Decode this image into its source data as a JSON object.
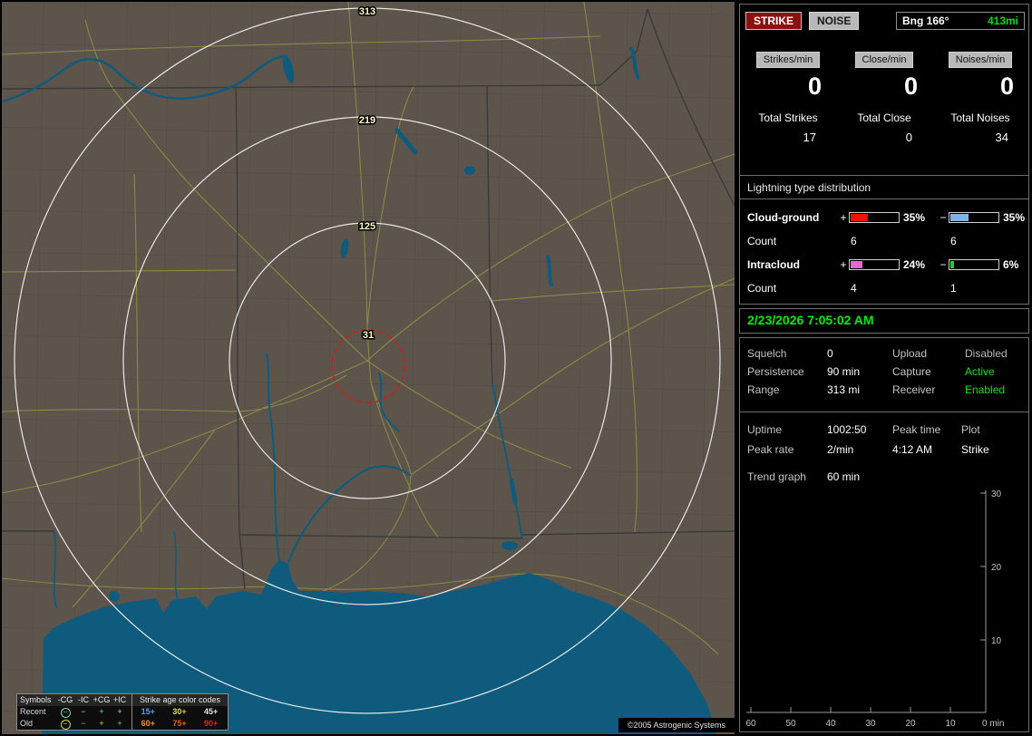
{
  "map": {
    "ring_labels": [
      "313",
      "219",
      "125",
      "31"
    ],
    "copyright": "©2005 Astrogenic Systems"
  },
  "legend": {
    "symbols_title": "Symbols",
    "col_headers": [
      "-CG",
      "-IC",
      "+CG",
      "+IC"
    ],
    "rows": [
      {
        "label": "Recent",
        "cells": [
          {
            "ch": "−",
            "style": "color:#7fd4a0"
          },
          {
            "ch": "−",
            "style": "color:#d0d0d0"
          },
          {
            "ch": "+",
            "style": "color:#7fd4a0"
          },
          {
            "ch": "+",
            "style": "color:#d0d0d0"
          }
        ]
      },
      {
        "label": "Old",
        "cells": [
          {
            "ch": "−",
            "style": "color:#d2d24a"
          },
          {
            "ch": "−",
            "style": "color:#b9b93e"
          },
          {
            "ch": "+",
            "style": "color:#d2d24a"
          },
          {
            "ch": "+",
            "style": "color:#b9b93e"
          }
        ]
      }
    ],
    "age_title": "Strike age color codes",
    "age_rows": [
      [
        {
          "label": "15+",
          "style": "color:#5b9bff"
        },
        {
          "label": "30+",
          "style": "color:#d8d855"
        },
        {
          "label": "45+",
          "style": "color:#e0e0e0"
        }
      ],
      [
        {
          "label": "60+",
          "style": "color:#e8973a"
        },
        {
          "label": "75+",
          "style": "color:#e85c28"
        },
        {
          "label": "90+",
          "style": "color:#e32222"
        }
      ]
    ]
  },
  "panel": {
    "strike_button": "STRIKE",
    "noise_button": "NOISE",
    "bearing_label": "Bng 166°",
    "bearing_value": "413mi",
    "rates": [
      {
        "label": "Strikes/min",
        "value": "0"
      },
      {
        "label": "Close/min",
        "value": "0"
      },
      {
        "label": "Noises/min",
        "value": "0"
      }
    ],
    "totals": [
      {
        "label": "Total Strikes",
        "value": "17"
      },
      {
        "label": "Total Close",
        "value": "0"
      },
      {
        "label": "Total Noises",
        "value": "34"
      }
    ],
    "distribution": {
      "title": "Lightning type distribution",
      "count_label": "Count",
      "rows": [
        {
          "name": "Cloud-ground",
          "plus_sign": "+",
          "plus_pct": "35%",
          "plus_bar": "width:35%;background:#ee1111",
          "minus_sign": "−",
          "minus_pct": "35%",
          "minus_bar": "width:37%;background:#7fb2e5",
          "plus_count": "6",
          "minus_count": "6"
        },
        {
          "name": "Intracloud",
          "plus_sign": "+",
          "plus_pct": "24%",
          "plus_bar": "width:24%;background:#ee66cc",
          "minus_sign": "−",
          "minus_pct": "6%",
          "minus_bar": "width:7%;background:#22cc22",
          "plus_count": "4",
          "minus_count": "1"
        }
      ]
    },
    "datetime": "2/23/2026 7:05:02 AM",
    "settings": [
      {
        "label1": "Squelch",
        "value1": "0",
        "label2": "Upload",
        "value2": "Disabled",
        "value2_style": "color:#b8b8b8"
      },
      {
        "label1": "Persistence",
        "value1": "90 min",
        "label2": "Capture",
        "value2": "Active",
        "value2_style": "color:#19e019"
      },
      {
        "label1": "Range",
        "value1": "313 mi",
        "label2": "Receiver",
        "value2": "Enabled",
        "value2_style": "color:#19e019"
      }
    ],
    "status": {
      "r1": [
        "Uptime",
        "1002:50",
        "Peak time",
        "Plot"
      ],
      "r2": [
        "Peak rate",
        "2/min",
        "4:12 AM",
        "Strike"
      ]
    },
    "trend_label": "Trend graph",
    "trend_value": "60 min",
    "chart": {
      "y_ticks": [
        "30",
        "20",
        "10"
      ],
      "x_ticks": [
        "60",
        "50",
        "40",
        "30",
        "20",
        "10"
      ],
      "origin": "0 min"
    }
  }
}
